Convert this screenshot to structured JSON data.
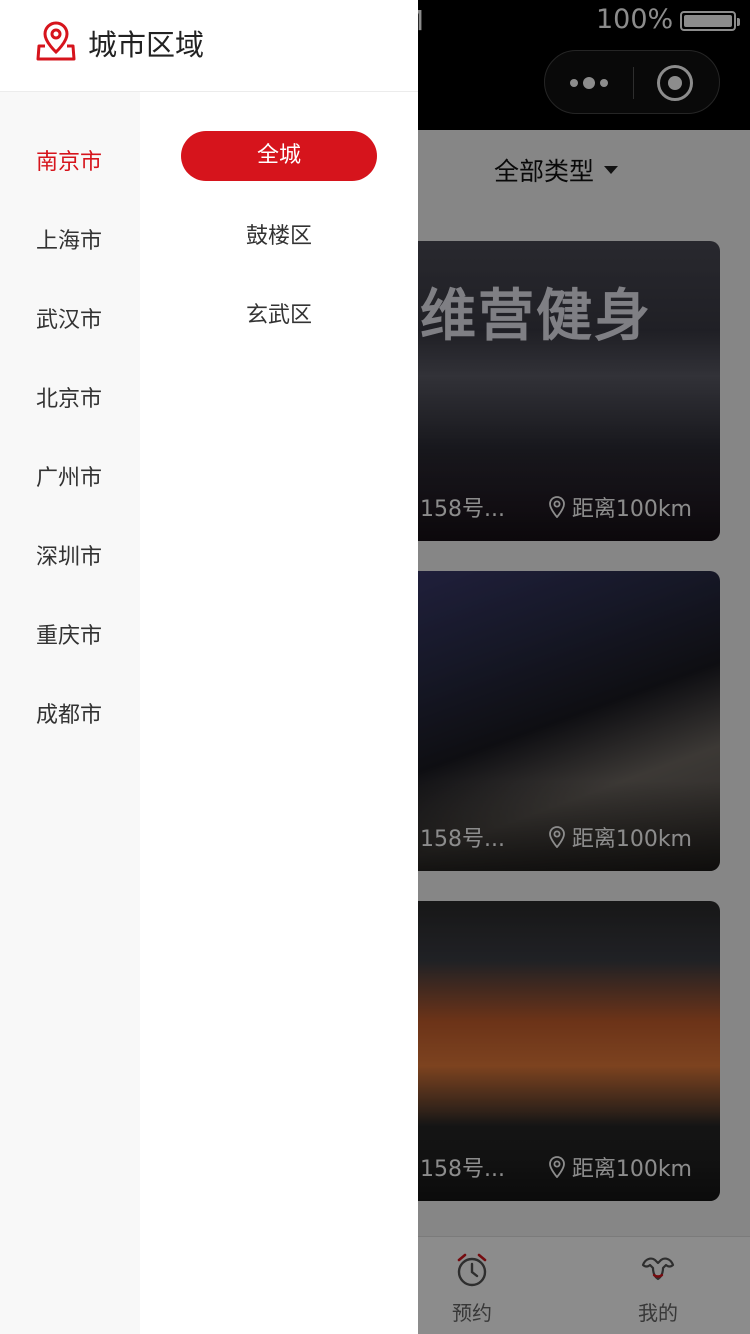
{
  "status_bar": {
    "time_fragment": "M",
    "battery": "100%"
  },
  "background": {
    "type_filter": "全部类型",
    "cards": [
      {
        "sign": "维营健身",
        "address": "158号...",
        "distance": "距离100km"
      },
      {
        "sign": "",
        "address": "158号...",
        "distance": "距离100km"
      },
      {
        "sign": "",
        "address": "158号...",
        "distance": "距离100km"
      }
    ],
    "tabs": [
      {
        "label": "预约",
        "icon": "alarm-clock-icon"
      },
      {
        "label": "我的",
        "icon": "muscle-icon"
      }
    ]
  },
  "drawer": {
    "title": "城市区域",
    "title_icon": "location-pin-icon",
    "cities": [
      "南京市",
      "上海市",
      "武汉市",
      "北京市",
      "广州市",
      "深圳市",
      "重庆市",
      "成都市"
    ],
    "selected_city": "南京市",
    "districts": [
      "全城",
      "鼓楼区",
      "玄武区"
    ],
    "selected_district": "全城"
  },
  "colors": {
    "accent": "#d6141c",
    "overlay": "rgba(0,0,0,0.45)"
  }
}
